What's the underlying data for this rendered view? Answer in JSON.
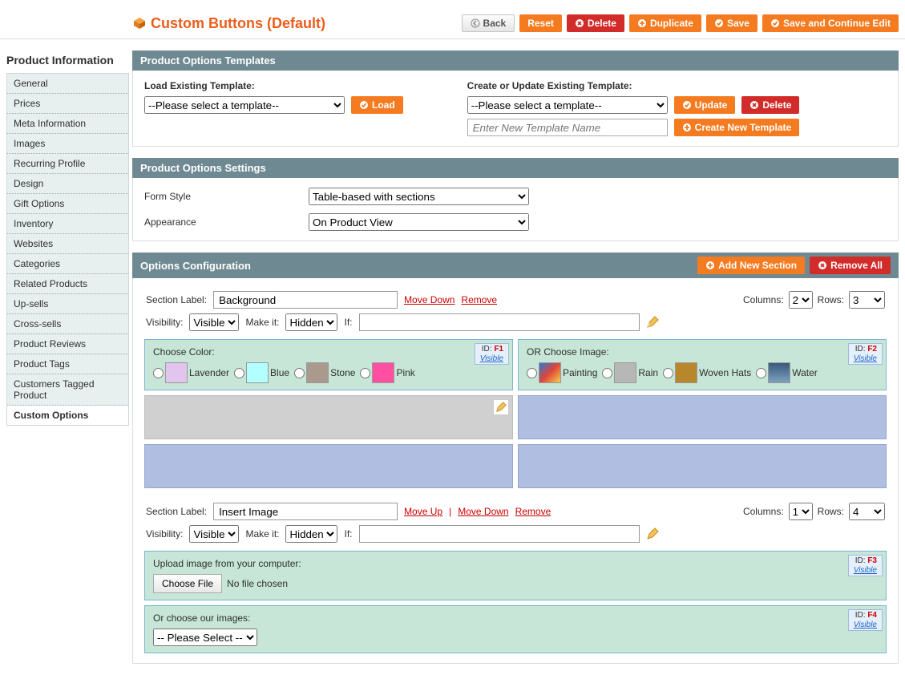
{
  "header": {
    "title": "Custom Buttons (Default)",
    "actions": {
      "back": "Back",
      "reset": "Reset",
      "delete": "Delete",
      "duplicate": "Duplicate",
      "save": "Save",
      "save_continue": "Save and Continue Edit"
    }
  },
  "sidebar": {
    "title": "Product Information",
    "items": [
      "General",
      "Prices",
      "Meta Information",
      "Images",
      "Recurring Profile",
      "Design",
      "Gift Options",
      "Inventory",
      "Websites",
      "Categories",
      "Related Products",
      "Up-sells",
      "Cross-sells",
      "Product Reviews",
      "Product Tags",
      "Customers Tagged Product",
      "Custom Options"
    ],
    "active": "Custom Options"
  },
  "templates": {
    "panel_title": "Product Options Templates",
    "load_label": "Load Existing Template:",
    "load_placeholder": "--Please select a template--",
    "load_btn": "Load",
    "create_label": "Create or Update Existing Template:",
    "create_placeholder": "--Please select a template--",
    "update_btn": "Update",
    "delete_btn": "Delete",
    "name_placeholder": "Enter New Template Name",
    "create_btn": "Create New Template"
  },
  "settings": {
    "panel_title": "Product Options Settings",
    "form_style_label": "Form Style",
    "form_style_value": "Table-based with sections",
    "appearance_label": "Appearance",
    "appearance_value": "On Product View"
  },
  "options": {
    "panel_title": "Options Configuration",
    "add_section": "Add New Section",
    "remove_all": "Remove All",
    "labels": {
      "section_label": "Section Label:",
      "visibility": "Visibility:",
      "make_it": "Make it:",
      "if": "If:",
      "columns": "Columns:",
      "rows": "Rows:",
      "move_up": "Move Up",
      "move_down": "Move Down",
      "remove": "Remove",
      "visibility_value": "Visible",
      "hidden_value": "Hidden",
      "id_prefix": "ID:",
      "visible_text": "Visible"
    },
    "section1": {
      "label": "Background",
      "columns": "2",
      "rows": "3",
      "cell1": {
        "title": "Choose Color:",
        "id": "F1",
        "swatches": [
          {
            "color": "#E1C5EC",
            "label": "Lavender"
          },
          {
            "color": "#B2FFFF",
            "label": "Blue"
          },
          {
            "color": "#A99A8D",
            "label": "Stone"
          },
          {
            "color": "#FF4FA2",
            "label": "Pink"
          }
        ]
      },
      "cell2": {
        "title": "OR Choose Image:",
        "id": "F2",
        "swatches": [
          {
            "label": "Painting"
          },
          {
            "label": "Rain"
          },
          {
            "label": "Woven Hats"
          },
          {
            "label": "Water"
          }
        ]
      }
    },
    "section2": {
      "label": "Insert Image",
      "columns": "1",
      "rows": "4",
      "cell1": {
        "title": "Upload image from your computer:",
        "id": "F3",
        "choose_file": "Choose File",
        "no_file": "No file chosen"
      },
      "cell2": {
        "title": "Or choose our images:",
        "id": "F4",
        "select_placeholder": "-- Please Select --"
      }
    }
  }
}
